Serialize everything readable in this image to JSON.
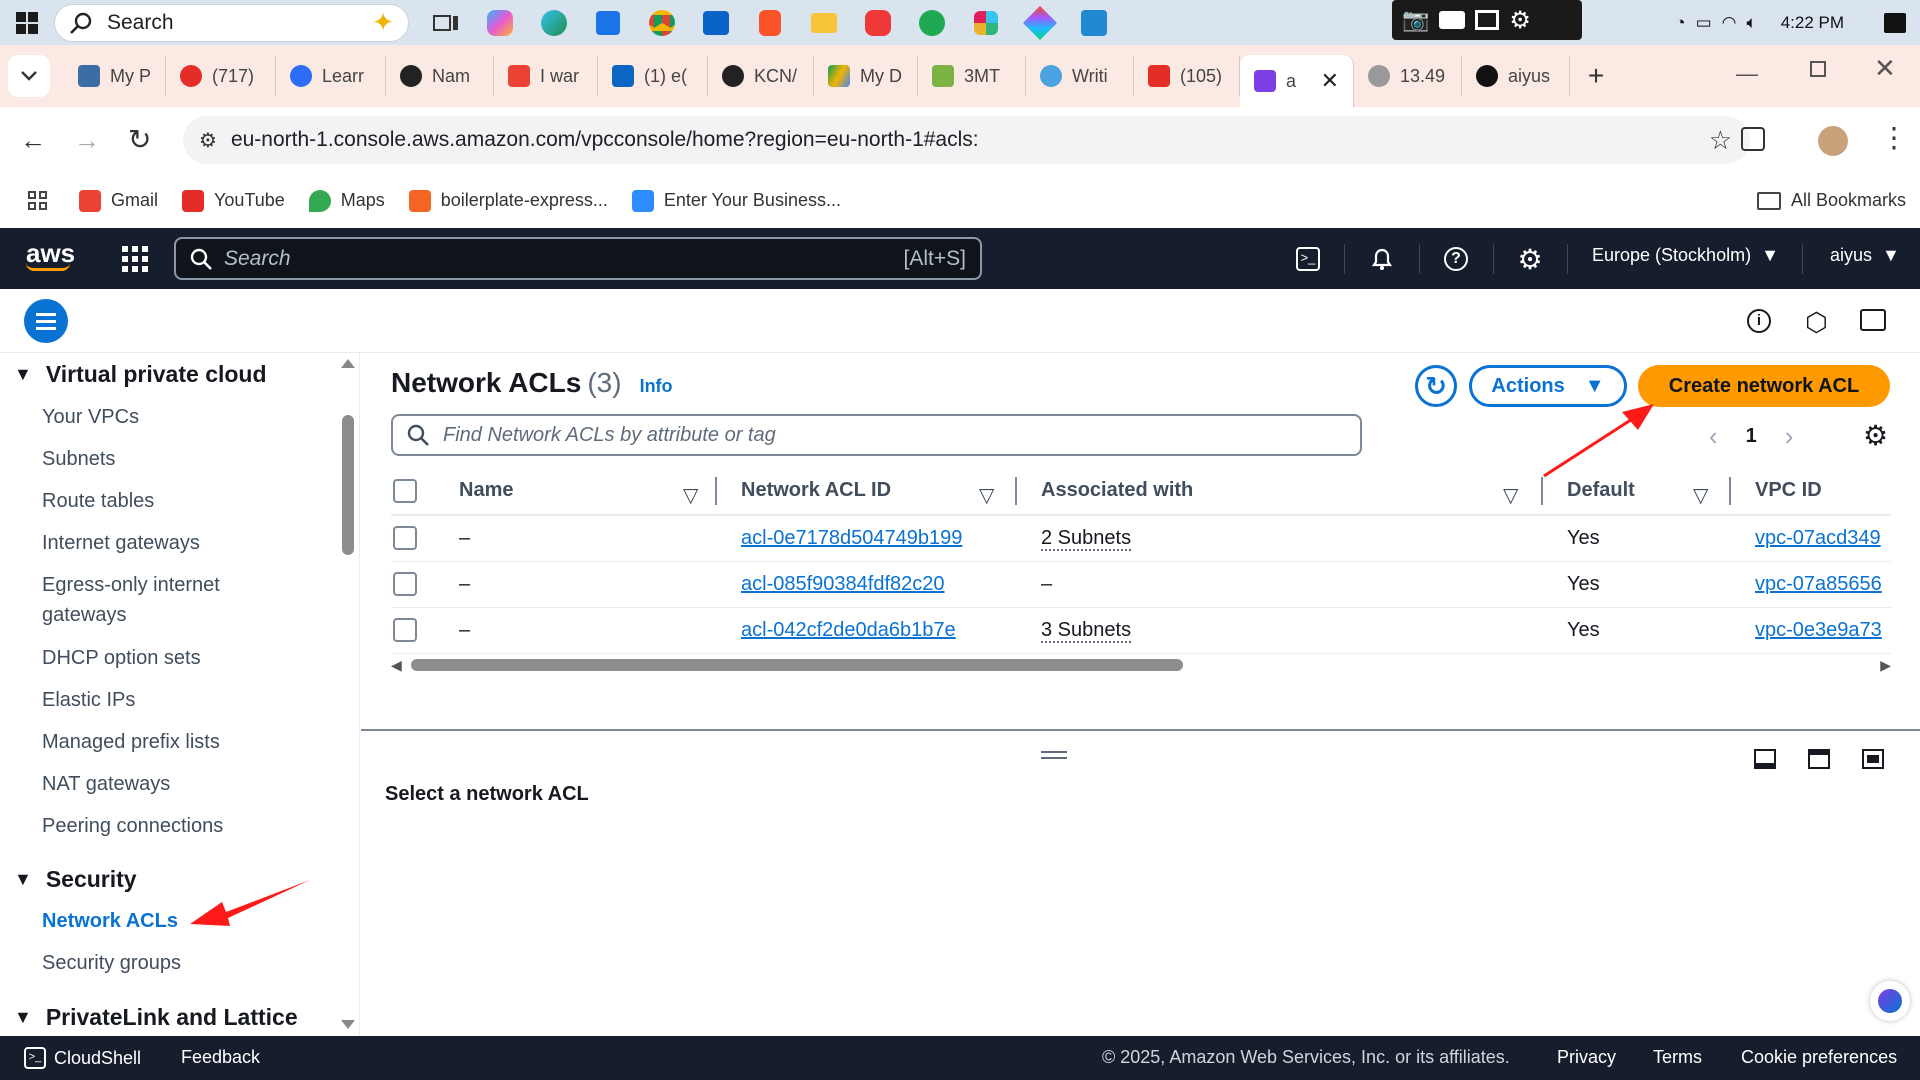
{
  "taskbar": {
    "search_label": "Search",
    "clock": "4:22 PM",
    "icons": [
      "copilot-icon",
      "edge-icon",
      "store-icon",
      "chrome-icon",
      "outlook-icon",
      "brave-icon",
      "explorer-icon",
      "vivaldi-icon",
      "whatsapp-icon",
      "slack-icon",
      "figma-icon",
      "vscode-icon"
    ]
  },
  "browser": {
    "tabs": [
      {
        "label": "My P"
      },
      {
        "label": "(717)"
      },
      {
        "label": "Learr"
      },
      {
        "label": "Nam"
      },
      {
        "label": "I war"
      },
      {
        "label": "(1) e("
      },
      {
        "label": "KCN/"
      },
      {
        "label": "My D"
      },
      {
        "label": "3MT"
      },
      {
        "label": "Writi"
      },
      {
        "label": "(105)"
      },
      {
        "label": "a"
      },
      {
        "label": "13.49"
      },
      {
        "label": "aiyus"
      }
    ],
    "url": "eu-north-1.console.aws.amazon.com/vpcconsole/home?region=eu-north-1#acls:",
    "bookmarks": [
      "Gmail",
      "YouTube",
      "Maps",
      "boilerplate-express...",
      "Enter Your Business..."
    ],
    "all_bookmarks": "All Bookmarks"
  },
  "aws_nav": {
    "logo": "aws",
    "search_placeholder": "Search",
    "search_shortcut": "[Alt+S]",
    "region": "Europe (Stockholm)",
    "user": "aiyus"
  },
  "sidebar": {
    "sections": [
      {
        "title": "Virtual private cloud",
        "items": [
          "Your VPCs",
          "Subnets",
          "Route tables",
          "Internet gateways",
          "Egress-only internet gateways",
          "DHCP option sets",
          "Elastic IPs",
          "Managed prefix lists",
          "NAT gateways",
          "Peering connections"
        ]
      },
      {
        "title": "Security",
        "items": [
          "Network ACLs",
          "Security groups"
        ]
      },
      {
        "title": "PrivateLink and Lattice",
        "items": []
      }
    ]
  },
  "main": {
    "title": "Network ACLs",
    "count": "(3)",
    "info": "Info",
    "actions_label": "Actions",
    "create_label": "Create network ACL",
    "filter_placeholder": "Find Network ACLs by attribute or tag",
    "page_number": "1",
    "columns": [
      "Name",
      "Network ACL ID",
      "Associated with",
      "Default",
      "VPC ID"
    ],
    "rows": [
      {
        "name": "–",
        "acl_id": "acl-0e7178d504749b199",
        "associated": "2 Subnets",
        "default": "Yes",
        "vpc_id": "vpc-07acd349"
      },
      {
        "name": "–",
        "acl_id": "acl-085f90384fdf82c20",
        "associated": "–",
        "default": "Yes",
        "vpc_id": "vpc-07a85656"
      },
      {
        "name": "–",
        "acl_id": "acl-042cf2de0da6b1b7e",
        "associated": "3 Subnets",
        "default": "Yes",
        "vpc_id": "vpc-0e3e9a73"
      }
    ]
  },
  "split_panel": {
    "title": "Select a network ACL"
  },
  "footer": {
    "cloudshell": "CloudShell",
    "feedback": "Feedback",
    "copyright": "© 2025, Amazon Web Services, Inc. or its affiliates.",
    "privacy": "Privacy",
    "terms": "Terms",
    "cookies": "Cookie preferences"
  },
  "colors": {
    "accent": "#0972d3",
    "primary_button": "#ff9900",
    "nav_bg": "#161e2d",
    "annotation_arrow": "#ff1a1a"
  }
}
